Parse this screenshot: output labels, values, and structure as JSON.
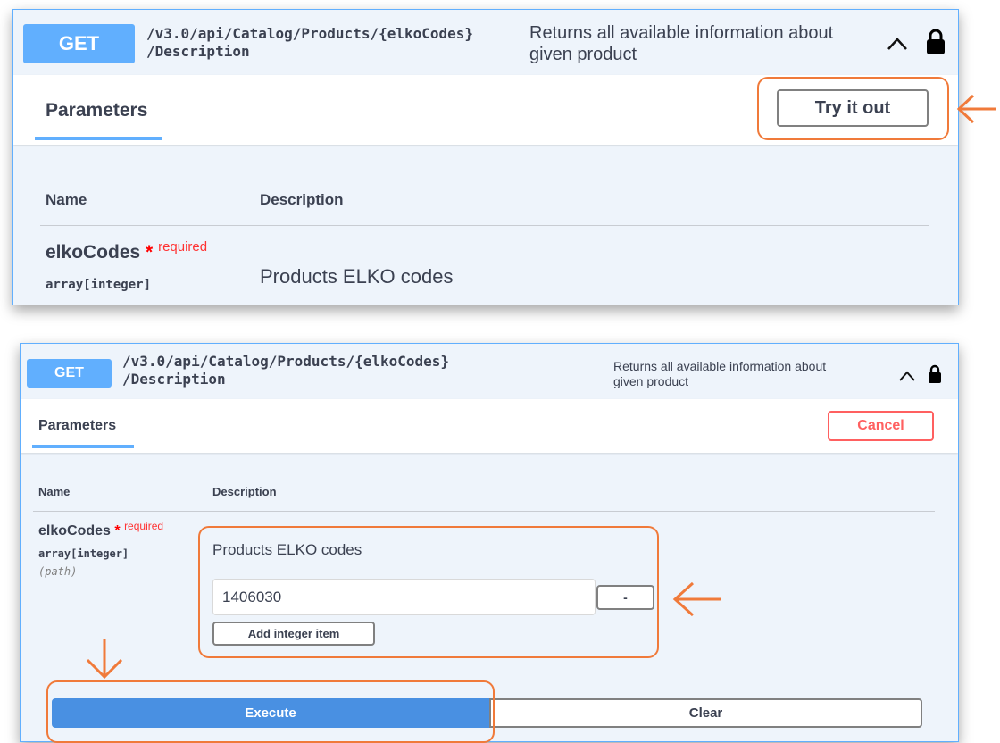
{
  "top": {
    "method": "GET",
    "path_line1": "/v3.0/api/Catalog/Products/{elkoCodes}",
    "path_line2": "/Description",
    "summary_line1": "Returns all available information about",
    "summary_line2": "given product",
    "tab_label": "Parameters",
    "try_button": "Try it out",
    "col_name": "Name",
    "col_desc": "Description",
    "param_name": "elkoCodes",
    "required_star": "*",
    "required_label": "required",
    "param_type": "array[integer]",
    "param_desc": "Products ELKO codes"
  },
  "bottom": {
    "method": "GET",
    "path_line1": "/v3.0/api/Catalog/Products/{elkoCodes}",
    "path_line2": "/Description",
    "summary_line1": "Returns all available information about",
    "summary_line2": "given product",
    "tab_label": "Parameters",
    "cancel_button": "Cancel",
    "col_name": "Name",
    "col_desc": "Description",
    "param_name": "elkoCodes",
    "required_star": "*",
    "required_label": "required",
    "param_type": "array[integer]",
    "param_in": "(path)",
    "param_desc": "Products ELKO codes",
    "input_value": "1406030",
    "remove_button": "-",
    "add_item_button": "Add integer item",
    "execute_button": "Execute",
    "clear_button": "Clear"
  },
  "colors": {
    "get_accent": "#61affe",
    "highlight": "#f07a3a",
    "execute": "#4990e2",
    "cancel": "#ff6060"
  },
  "icons": [
    "chevron-up-icon",
    "lock-icon",
    "arrow-left-icon",
    "arrow-down-icon"
  ]
}
